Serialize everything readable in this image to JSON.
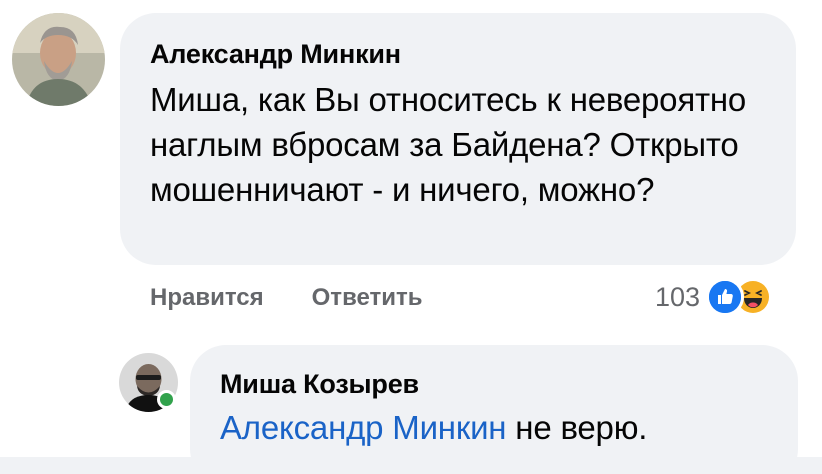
{
  "comment": {
    "author": "Александр Минкин",
    "text": "Миша, как Вы относитесь к невероятно наглым вбросам за Байдена? Открыто мошенничают - и ничего, можно?",
    "actions": {
      "like_label": "Нравится",
      "reply_label": "Ответить"
    },
    "reactions": {
      "count": "103",
      "icons": [
        "like-icon",
        "haha-icon"
      ]
    },
    "avatar_icon": "person-photo"
  },
  "reply": {
    "author": "Миша Козырев",
    "mention": "Александр Минкин",
    "text": " не верю.",
    "avatar_icon": "person-photo",
    "online": true
  },
  "colors": {
    "bubble": "#f0f2f5",
    "mention": "#1a63c7",
    "secondary_text": "#65676b",
    "like": "#1877f2",
    "haha": "#f7b125",
    "online": "#31a24c"
  }
}
